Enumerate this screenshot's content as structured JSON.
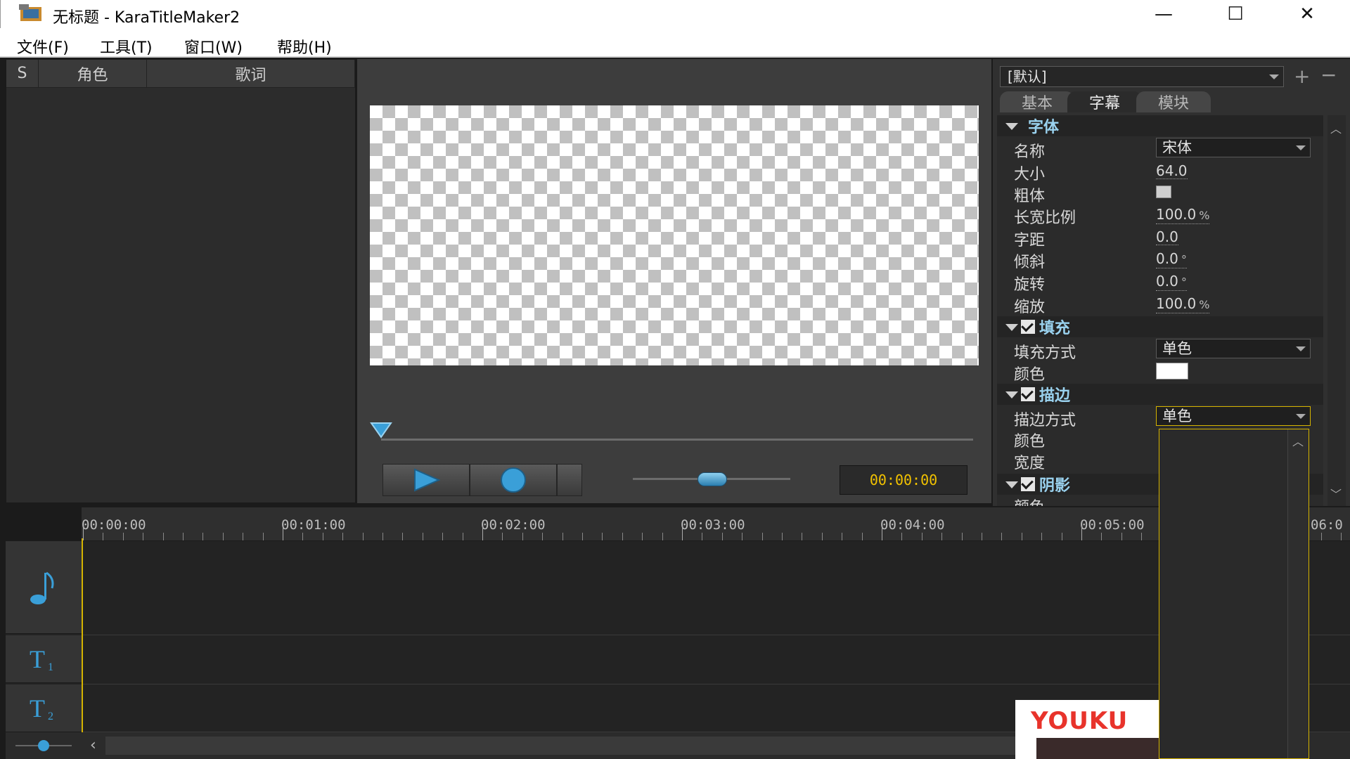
{
  "window": {
    "title": "无标题 - KaraTitleMaker2",
    "controls": {
      "minimize": "—",
      "maximize": "☐",
      "close": "✕"
    }
  },
  "menu": [
    "文件(F)",
    "工具(T)",
    "窗口(W)",
    "帮助(H)"
  ],
  "lyrics_table": {
    "columns": [
      "S",
      "角色",
      "歌词"
    ]
  },
  "transport": {
    "time": "00:00:00"
  },
  "props": {
    "preset": "[默认]",
    "tabs": [
      "基本",
      "字幕",
      "模块"
    ],
    "active_tab": "字幕",
    "font": {
      "header": "字体",
      "name_label": "名称",
      "name_value": "宋体",
      "size_label": "大小",
      "size_value": "64.0",
      "bold_label": "粗体",
      "aspect_label": "长宽比例",
      "aspect_value": "100.0",
      "aspect_unit": "%",
      "spacing_label": "字距",
      "spacing_value": "0.0",
      "slant_label": "倾斜",
      "slant_value": "0.0",
      "slant_unit": "°",
      "rotate_label": "旋转",
      "rotate_value": "0.0",
      "rotate_unit": "°",
      "scale_label": "缩放",
      "scale_value": "100.0",
      "scale_unit": "%"
    },
    "fill": {
      "header": "填充",
      "mode_label": "填充方式",
      "mode_value": "单色",
      "color_label": "颜色",
      "color": "#ffffff"
    },
    "stroke": {
      "header": "描边",
      "mode_label": "描边方式",
      "mode_value": "单色",
      "color_label": "颜色",
      "width_label": "宽度"
    },
    "shadow": {
      "header": "阴影",
      "color_label": "颜色"
    }
  },
  "timeline": {
    "ticks": [
      "00:00:00",
      "00:01:00",
      "00:02:00",
      "00:03:00",
      "00:04:00",
      "00:05:00",
      "06:0"
    ]
  },
  "watermark": {
    "text": "YOUKU"
  },
  "colors": {
    "accent_blue": "#3a9fd8",
    "time_yellow": "#f2c200",
    "highlight_border": "#d6b400"
  }
}
